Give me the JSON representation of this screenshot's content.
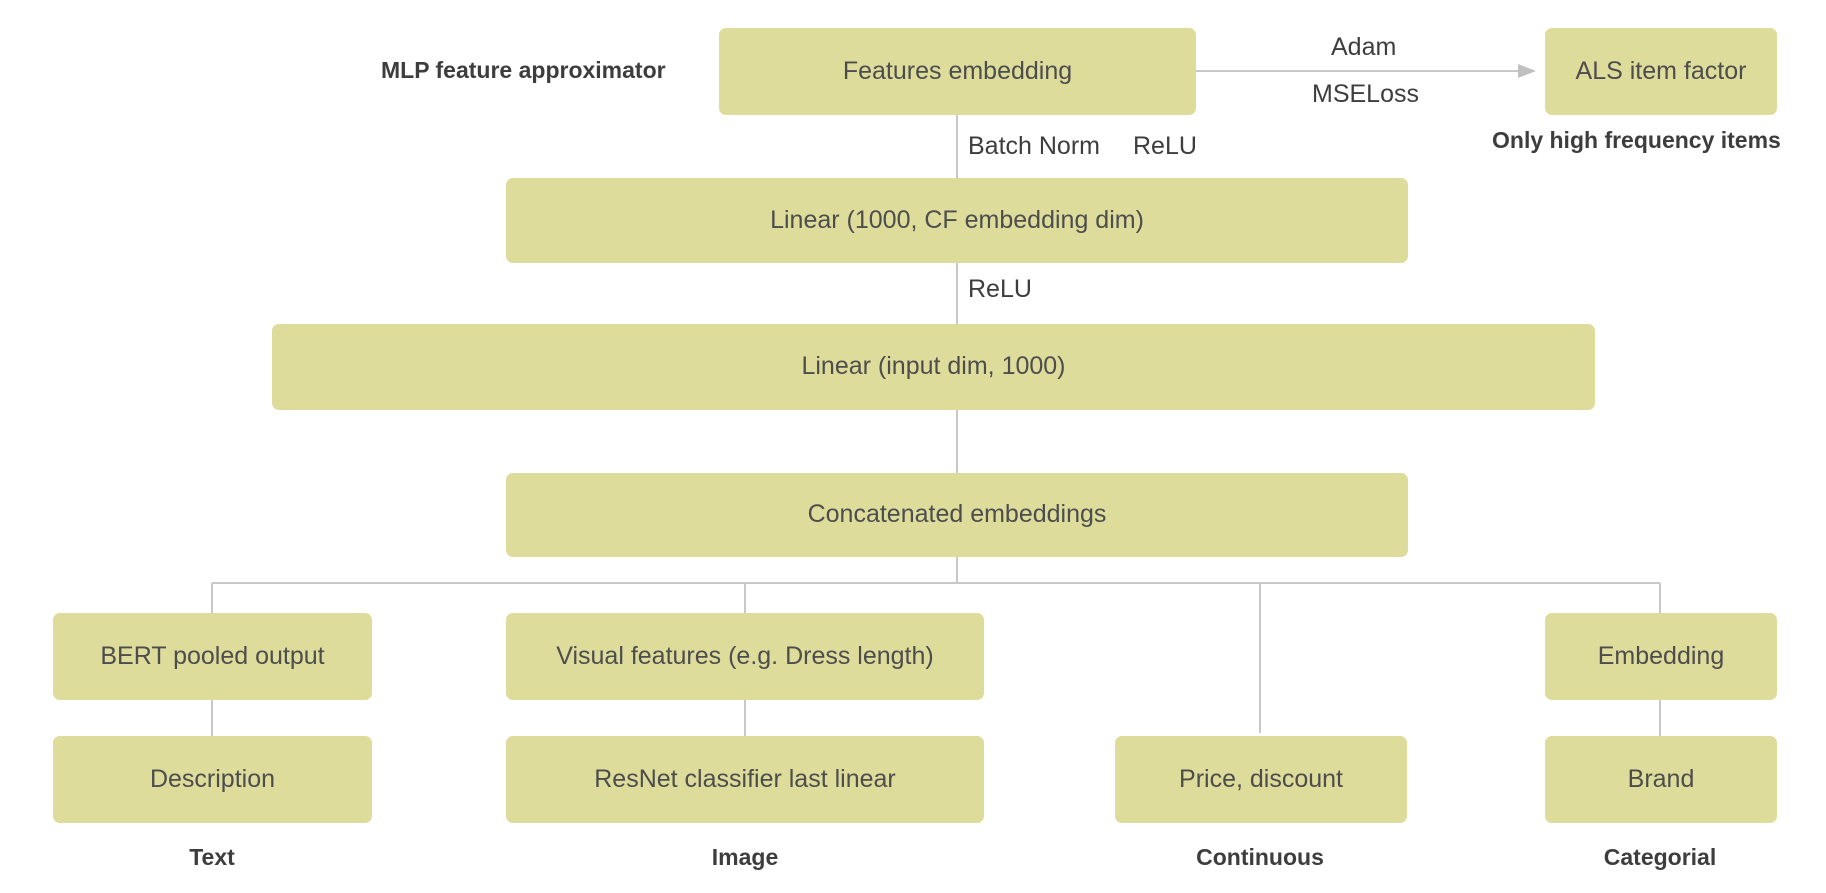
{
  "diagram": {
    "title_label": "MLP feature approximator",
    "note_label": "Only high frequency items",
    "accent_color": "#dedc9a",
    "line_color": "#c8c8c8",
    "text_color": "#4d4d4d",
    "nodes": {
      "features_embedding": "Features embedding",
      "als_item_factor": "ALS item factor",
      "linear_cf": "Linear (1000, CF embedding dim)",
      "linear_input": "Linear (input dim, 1000)",
      "concatenated": "Concatenated embeddings",
      "bert_pooled": "BERT pooled output",
      "visual_features": "Visual features (e.g. Dress length)",
      "embedding": "Embedding",
      "description": "Description",
      "resnet_classifier": "ResNet classifier last linear",
      "price_discount": "Price, discount",
      "brand": "Brand"
    },
    "edge_labels": {
      "adam": "Adam",
      "mseloss": "MSELoss",
      "batch_norm": "Batch Norm",
      "relu_top": "ReLU",
      "relu_mid": "ReLU"
    },
    "column_labels": {
      "text": "Text",
      "image": "Image",
      "continuous": "Continuous",
      "categorial": "Categorial"
    }
  }
}
